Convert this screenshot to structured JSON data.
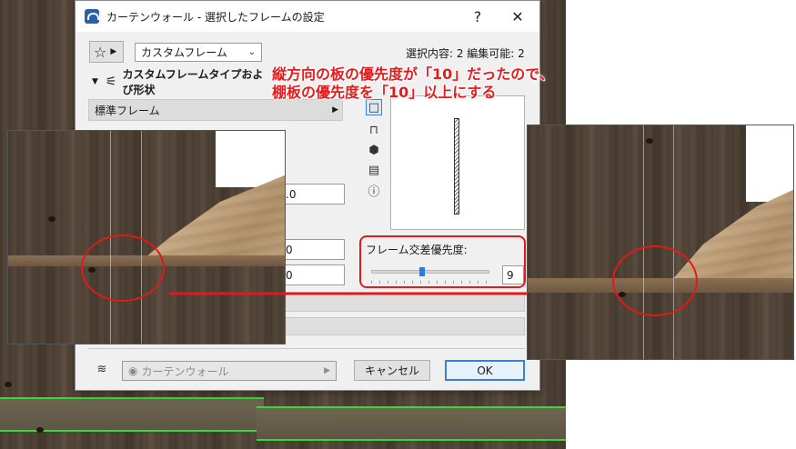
{
  "dialog": {
    "title": "カーテンウォール - 選択したフレームの設定",
    "help_label": "?",
    "close_label": "✕",
    "selection_info": "選択内容: 2 編集可能: 2",
    "preset_dropdown": "カスタムフレーム",
    "section_header": "カスタムフレームタイプおよび形状",
    "frame_type_dropdown": "標準フレーム",
    "value_field_1": ".0",
    "value_field_2": "0",
    "value_field_3": "0",
    "priority_label": "フレーム交差優先度:",
    "priority_value": "9",
    "priority_slider_fraction": 0.43,
    "layer_dropdown": "カーテンウォール",
    "cancel_label": "キャンセル",
    "ok_label": "OK"
  },
  "annotation": {
    "line1": "縦方向の板の優先度が「10」だったので、",
    "line2": "棚板の優先度を「10」以上にする"
  },
  "colors": {
    "accent_red": "#e01a1a",
    "highlight_green": "#38d838",
    "ok_border": "#3c7fd4"
  }
}
